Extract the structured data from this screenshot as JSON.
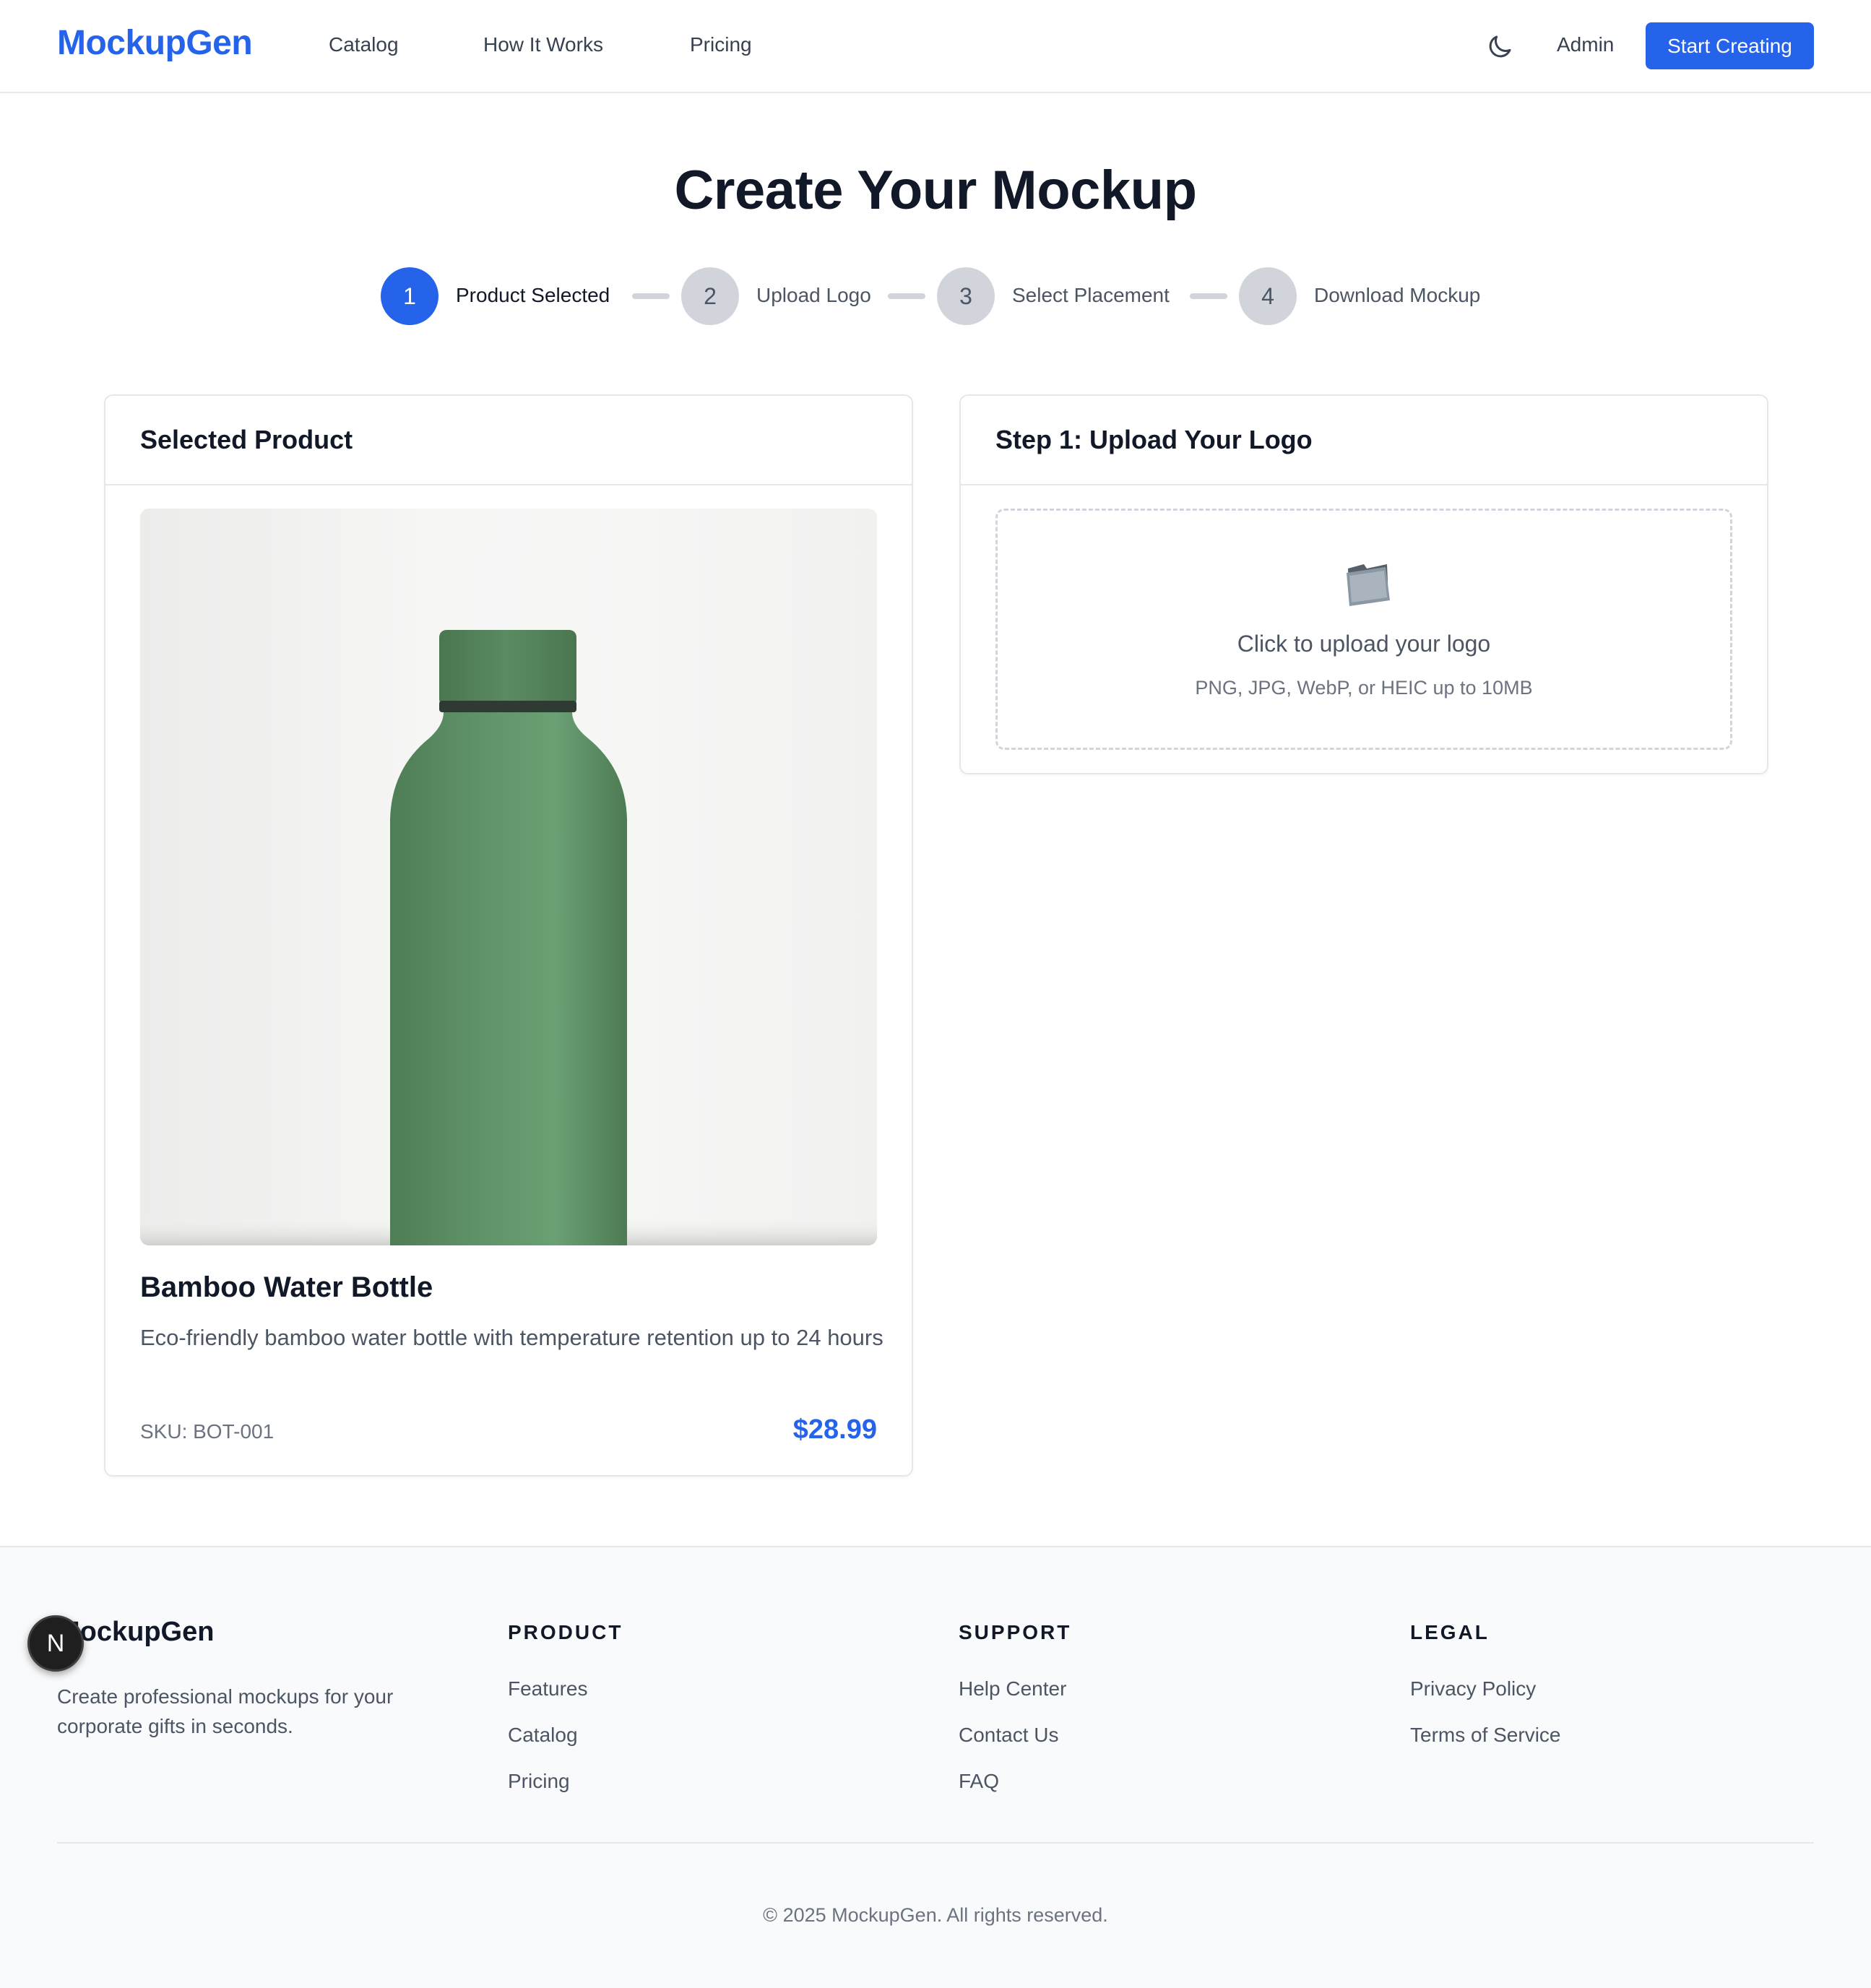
{
  "header": {
    "logo": "MockupGen",
    "nav": [
      "Catalog",
      "How It Works",
      "Pricing"
    ],
    "theme_icon": "moon-icon",
    "admin_label": "Admin",
    "cta_label": "Start Creating"
  },
  "page": {
    "title": "Create Your Mockup"
  },
  "steps": [
    {
      "number": "1",
      "label": "Product Selected",
      "active": true
    },
    {
      "number": "2",
      "label": "Upload Logo",
      "active": false
    },
    {
      "number": "3",
      "label": "Select Placement",
      "active": false
    },
    {
      "number": "4",
      "label": "Download Mockup",
      "active": false
    }
  ],
  "product_card": {
    "heading": "Selected Product",
    "name": "Bamboo Water Bottle",
    "description": "Eco-friendly bamboo water bottle with temperature retention up to 24 hours",
    "sku": "SKU: BOT-001",
    "price": "$28.99"
  },
  "upload_card": {
    "heading": "Step 1: Upload Your Logo",
    "icon": "folder-icon",
    "title": "Click to upload your logo",
    "hint": "PNG, JPG, WebP, or HEIC up to 10MB"
  },
  "footer": {
    "brand": "MockupGen",
    "tagline": "Create professional mockups for your corporate gifts in seconds.",
    "columns": [
      {
        "title": "PRODUCT",
        "links": [
          "Features",
          "Catalog",
          "Pricing"
        ]
      },
      {
        "title": "SUPPORT",
        "links": [
          "Help Center",
          "Contact Us",
          "FAQ"
        ]
      },
      {
        "title": "LEGAL",
        "links": [
          "Privacy Policy",
          "Terms of Service"
        ]
      }
    ],
    "copyright": "© 2025 MockupGen. All rights reserved."
  },
  "dev_badge": {
    "label": "N"
  },
  "colors": {
    "accent": "#2563eb",
    "step_idle": "#d1d5db",
    "bottle_green": "#5f8f66",
    "footer_bg": "#f9fafb"
  }
}
